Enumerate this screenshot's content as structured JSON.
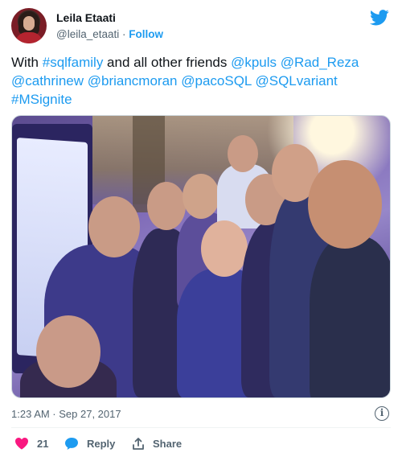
{
  "author": {
    "name": "Leila Etaati",
    "handle": "@leila_etaati",
    "separator": " · ",
    "follow_label": "Follow"
  },
  "tweet": {
    "t1": "With ",
    "h1": "#sqlfamily",
    "t2": " and all other friends ",
    "m1": "@kpuls",
    "m2": "@Rad_Reza",
    "m3": "@cathrinew",
    "m4": "@briancmoran",
    "m5": "@pacoSQL",
    "m6": "@SQLvariant",
    "h2": "#MSignite"
  },
  "photo": {
    "description_icon": "group-selfie-photo"
  },
  "meta": {
    "timestamp": "1:23 AM · Sep 27, 2017"
  },
  "actions": {
    "like_count": "21",
    "reply_label": "Reply",
    "share_label": "Share"
  },
  "colors": {
    "link": "#1d9bf0",
    "heart": "#f91880",
    "reply_bubble": "#1d9bf0",
    "muted": "#536471"
  },
  "icons": [
    "twitter-bird-icon",
    "info-icon",
    "heart-icon",
    "reply-bubble-icon",
    "share-icon"
  ]
}
